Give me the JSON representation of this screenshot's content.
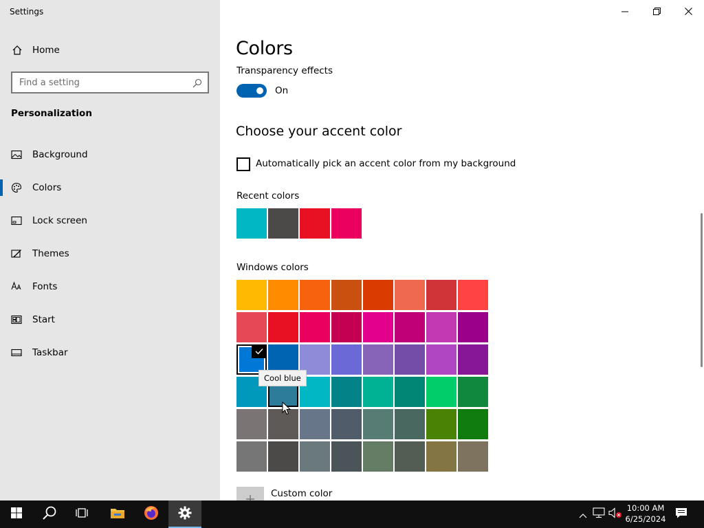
{
  "window": {
    "title": "Settings",
    "minimize_icon": "minimize-icon",
    "restore_icon": "restore-icon",
    "close_icon": "close-icon"
  },
  "sidebar": {
    "home_label": "Home",
    "search_placeholder": "Find a setting",
    "section_title": "Personalization",
    "items": [
      {
        "label": "Background",
        "icon": "picture-icon"
      },
      {
        "label": "Colors",
        "icon": "palette-icon",
        "active": true
      },
      {
        "label": "Lock screen",
        "icon": "lock-screen-icon"
      },
      {
        "label": "Themes",
        "icon": "themes-icon"
      },
      {
        "label": "Fonts",
        "icon": "fonts-icon"
      },
      {
        "label": "Start",
        "icon": "start-icon"
      },
      {
        "label": "Taskbar",
        "icon": "taskbar-icon"
      }
    ]
  },
  "main": {
    "title": "Colors",
    "transparency_label": "Transparency effects",
    "transparency_state": "On",
    "accent_heading": "Choose your accent color",
    "auto_pick_label": "Automatically pick an accent color from my background",
    "recent_label": "Recent colors",
    "recent_colors": [
      "#00b7c3",
      "#4c4a48",
      "#e81123",
      "#ea005e"
    ],
    "windows_label": "Windows colors",
    "windows_colors": [
      [
        "#ffb900",
        "#ff8c00",
        "#f7630c",
        "#ca5010",
        "#da3b01",
        "#ef6950",
        "#d13438",
        "#ff4343"
      ],
      [
        "#e74856",
        "#e81123",
        "#ea005e",
        "#c30052",
        "#e3008c",
        "#bf0077",
        "#c239b3",
        "#9a0089"
      ],
      [
        "#0078d7",
        "#0063b1",
        "#8e8cd8",
        "#6b69d6",
        "#8764b8",
        "#744da9",
        "#b146c2",
        "#881798"
      ],
      [
        "#0099bc",
        "#2d7d9a",
        "#00b7c3",
        "#038387",
        "#00b294",
        "#018574",
        "#00cc6a",
        "#10893e"
      ],
      [
        "#7a7574",
        "#5d5a58",
        "#68768a",
        "#515c6b",
        "#567c73",
        "#486860",
        "#498205",
        "#107c10"
      ],
      [
        "#767676",
        "#4c4a48",
        "#69797e",
        "#4a5459",
        "#647c64",
        "#525e54",
        "#847545",
        "#7e735f"
      ]
    ],
    "selected_color": "#0078d7",
    "tooltip": "Cool blue",
    "custom_color_label": "Custom color"
  },
  "taskbar": {
    "time": "10:00 AM",
    "date": "6/25/2024"
  }
}
